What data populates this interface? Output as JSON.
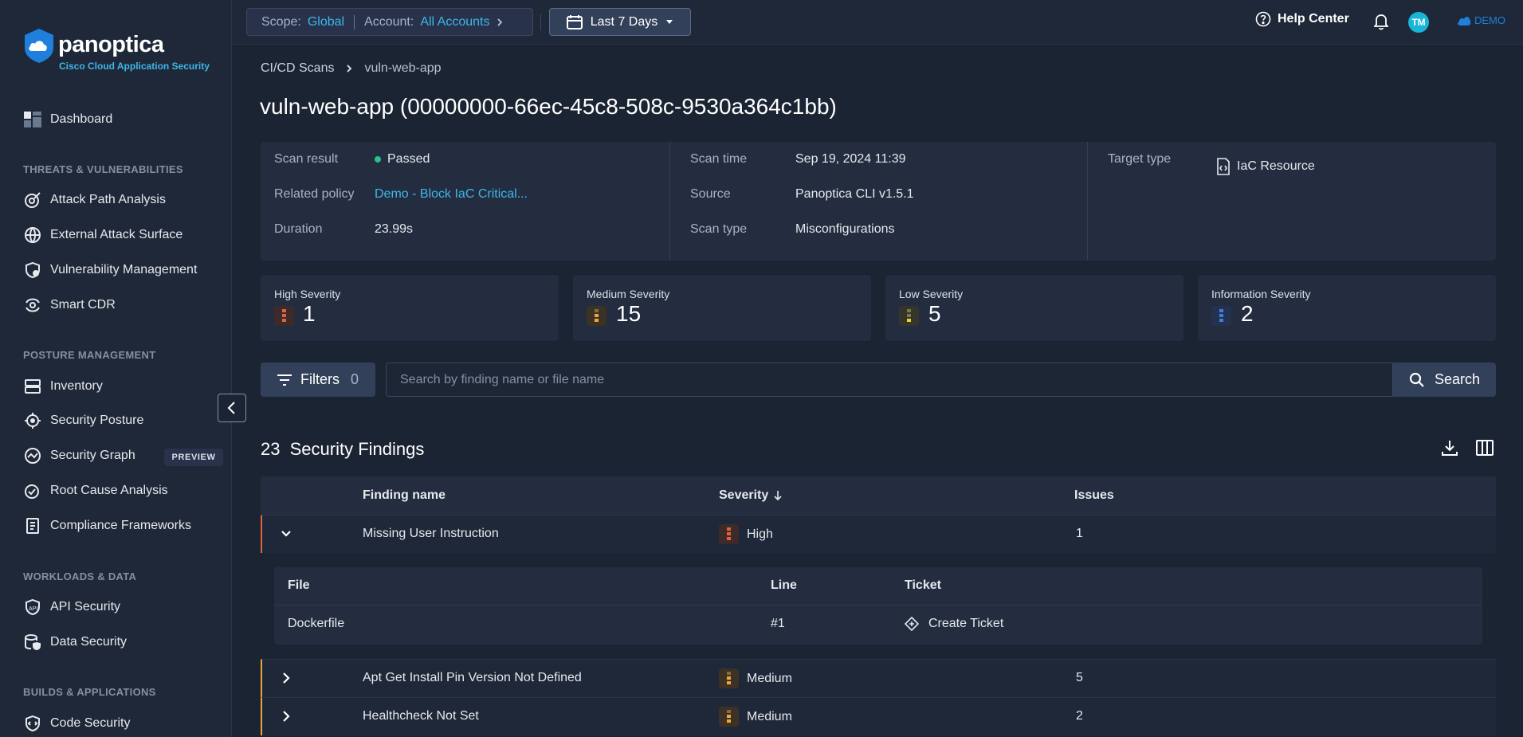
{
  "brand": {
    "name": "panoptica",
    "subtitle": "Cisco Cloud Application Security"
  },
  "sidebar": {
    "dashboard": "Dashboard",
    "sections": [
      {
        "title": "THREATS & VULNERABILITIES",
        "items": [
          "Attack Path Analysis",
          "External Attack Surface",
          "Vulnerability Management",
          "Smart CDR"
        ]
      },
      {
        "title": "POSTURE MANAGEMENT",
        "items": [
          "Inventory",
          "Security Posture",
          "Security Graph",
          "Root Cause Analysis",
          "Compliance Frameworks"
        ]
      },
      {
        "title": "WORKLOADS & DATA",
        "items": [
          "API Security",
          "Data Security"
        ]
      },
      {
        "title": "BUILDS & APPLICATIONS",
        "items": [
          "Code Security"
        ]
      }
    ],
    "preview_badge": "PREVIEW"
  },
  "topbar": {
    "scope_label": "Scope:",
    "scope_value": "Global",
    "account_label": "Account:",
    "account_value": "All Accounts",
    "date_range": "Last 7 Days",
    "help": "Help Center",
    "avatar": "TM",
    "env": "DEMO"
  },
  "breadcrumb": {
    "parent": "CI/CD Scans",
    "current": "vuln-web-app"
  },
  "page_title": "vuln-web-app (00000000-66ec-45c8-508c-9530a364c1bb)",
  "scan_info": {
    "scan_result_label": "Scan result",
    "scan_result": "Passed",
    "related_policy_label": "Related policy",
    "related_policy": "Demo - Block IaC Critical...",
    "duration_label": "Duration",
    "duration": "23.99s",
    "scan_time_label": "Scan time",
    "scan_time": "Sep 19, 2024 11:39",
    "source_label": "Source",
    "source": "Panoptica CLI v1.5.1",
    "scan_type_label": "Scan type",
    "scan_type": "Misconfigurations",
    "target_type_label": "Target type",
    "target_type": "IaC Resource"
  },
  "severity_cards": [
    {
      "title": "High Severity",
      "count": "1",
      "color": "#e2623d"
    },
    {
      "title": "Medium Severity",
      "count": "15",
      "color": "#f0a53a"
    },
    {
      "title": "Low Severity",
      "count": "5",
      "color": "#e8d23a"
    },
    {
      "title": "Information Severity",
      "count": "2",
      "color": "#3f7fdc"
    }
  ],
  "filters": {
    "label": "Filters",
    "count": "0"
  },
  "search": {
    "placeholder": "Search by finding name or file name",
    "button": "Search"
  },
  "findings": {
    "count": "23",
    "title": "Security Findings",
    "columns": [
      "Finding name",
      "Severity",
      "Issues"
    ],
    "rows": [
      {
        "name": "Missing User Instruction",
        "severity": "High",
        "issues": "1"
      },
      {
        "name": "Apt Get Install Pin Version Not Defined",
        "severity": "Medium",
        "issues": "5"
      },
      {
        "name": "Healthcheck Not Set",
        "severity": "Medium",
        "issues": "2"
      }
    ],
    "expanded": {
      "columns": [
        "File",
        "Line",
        "Ticket"
      ],
      "file": "Dockerfile",
      "line": "#1",
      "ticket": "Create Ticket"
    }
  }
}
